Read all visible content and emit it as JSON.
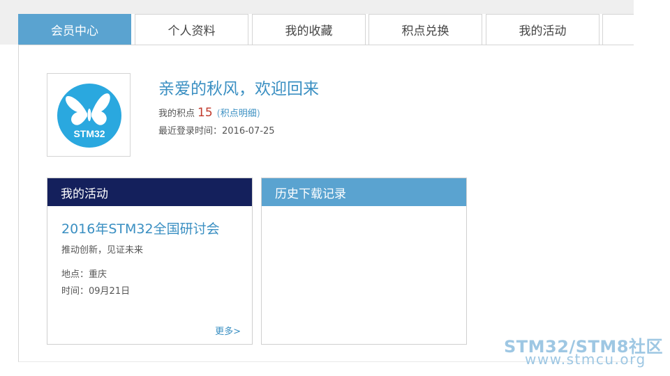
{
  "tabs": [
    {
      "label": "会员中心",
      "active": true
    },
    {
      "label": "个人资料",
      "active": false
    },
    {
      "label": "我的收藏",
      "active": false
    },
    {
      "label": "积点兑换",
      "active": false
    },
    {
      "label": "我的活动",
      "active": false
    },
    {
      "label": "",
      "active": false
    }
  ],
  "profile": {
    "avatar_text": "STM32",
    "welcome": "亲爱的秋风，欢迎回来",
    "points_label": "我的积点",
    "points_value": "15",
    "points_link_open": "(",
    "points_link": "积点明细",
    "points_link_close": ")",
    "last_login": "最近登录时间：2016-07-25"
  },
  "activity": {
    "header": "我的活动",
    "title": "2016年STM32全国研讨会",
    "subtitle": "推动创新，见证未来",
    "location": "地点：重庆",
    "time": "时间：09月21日",
    "more": "更多>"
  },
  "downloads": {
    "header": "历史下载记录"
  },
  "watermark": {
    "line1": "STM32/STM8社区",
    "line2": "www.stmcu.org"
  },
  "colors": {
    "accent": "#5aa3d0",
    "dark_header": "#14205c",
    "link": "#3a8fc2",
    "points": "#c0392b"
  },
  "icons": {
    "avatar": "butterfly-logo"
  }
}
